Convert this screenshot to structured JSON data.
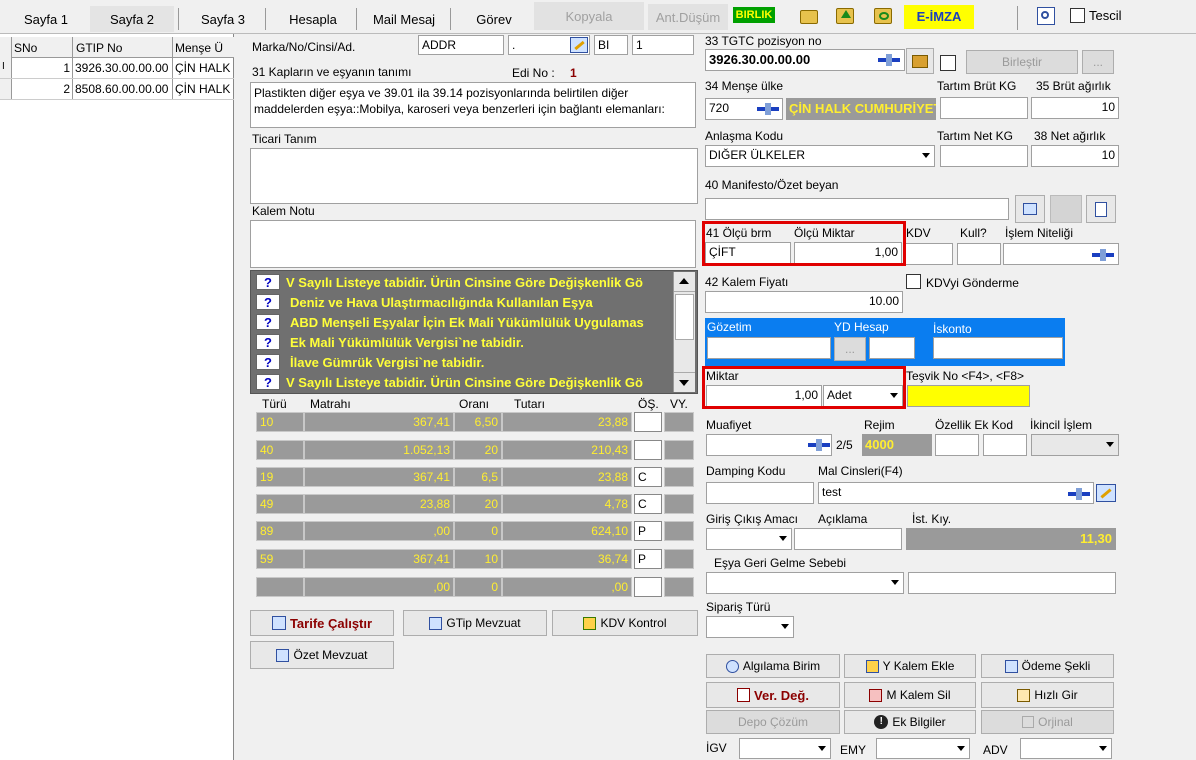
{
  "tabs": [
    {
      "label": "Sayfa 1"
    },
    {
      "label": "Sayfa 2"
    },
    {
      "label": "Sayfa 3"
    },
    {
      "label": "Hesapla"
    },
    {
      "label": "Mail Mesaj"
    },
    {
      "label": "Görev"
    },
    {
      "label": "Kopyala"
    },
    {
      "label": "Ant.Düşüm"
    }
  ],
  "toolbar": {
    "birlik": "BIRLIK",
    "eimza": "E-İMZA",
    "tescil": "Tescil"
  },
  "left_table": {
    "headers": [
      "SNo",
      "GTIP No",
      "Menşe Ü"
    ],
    "rows": [
      {
        "sno": "1",
        "gtip": "3926.30.00.00.00",
        "mense": "ÇİN HALK"
      },
      {
        "sno": "2",
        "gtip": "8508.60.00.00.00",
        "mense": "ÇİN HALK"
      }
    ]
  },
  "form": {
    "marka_label": "Marka/No/Cinsi/Ad.",
    "marka_val1": "ADDR",
    "marka_val2": ".",
    "marka_val3": "BI",
    "marka_val4": "1",
    "kaplar_label": "31 Kapların ve eşyanın tanımı",
    "edi_label": "Edi No :",
    "edi_val": "1",
    "esya_tanim": "Plastikten diğer eşya ve 39.01 ila 39.14 pozisyonlarında belirtilen diğer maddelerden eşya::Mobilya, karoseri veya benzerleri için bağlantı elemanları:",
    "ticari_label": "Ticari Tanım",
    "kalem_notu_label": "Kalem Notu",
    "warnings": [
      "V Sayılı Listeye tabidir. Ürün Cinsine Göre Değişkenlik Gö",
      "Deniz ve Hava Ulaştırmacılığında Kullanılan Eşya",
      "ABD Menşeli Eşyalar İçin Ek Mali Yükümlülük Uygulamas",
      "Ek Mali Yükümlülük Vergisi`ne tabidir.",
      "İlave Gümrük Vergisi`ne tabidir.",
      "V Sayılı Listeye tabidir. Ürün Cinsine Göre Değişkenlik Gö"
    ],
    "tax_headers": [
      "Türü",
      "Matrahı",
      "Oranı",
      "Tutarı",
      "ÖŞ.",
      "VY."
    ],
    "tax_rows": [
      {
        "tur": "10",
        "matrah": "367,41",
        "oran": "6,50",
        "tutar": "23,88",
        "os": ""
      },
      {
        "tur": "40",
        "matrah": "1.052,13",
        "oran": "20",
        "tutar": "210,43",
        "os": ""
      },
      {
        "tur": "19",
        "matrah": "367,41",
        "oran": "6,5",
        "tutar": "23,88",
        "os": "C"
      },
      {
        "tur": "49",
        "matrah": "23,88",
        "oran": "20",
        "tutar": "4,78",
        "os": "C"
      },
      {
        "tur": "89",
        "matrah": ",00",
        "oran": "0",
        "tutar": "624,10",
        "os": "P"
      },
      {
        "tur": "59",
        "matrah": "367,41",
        "oran": "10",
        "tutar": "36,74",
        "os": "P"
      },
      {
        "tur": "",
        "matrah": ",00",
        "oran": "0",
        "tutar": ",00",
        "os": ""
      }
    ],
    "btn_tarife": "Tarife Çalıştır",
    "btn_gtip": "GTip Mevzuat",
    "btn_kdv": "KDV Kontrol",
    "btn_ozet": "Özet Mevzuat"
  },
  "right": {
    "tgtc_label": "33 TGTC pozisyon no",
    "tgtc_val": "3926.30.00.00.00",
    "birlestir": "Birleştir",
    "mense_label": "34 Menşe ülke",
    "mense_code": "720",
    "mense_name": "ÇİN HALK CUMHURİYETİ",
    "tartim_brut_label": "Tartım Brüt KG",
    "brut_label": "35 Brüt ağırlık",
    "brut_val": "10",
    "anlasma_label": "Anlaşma Kodu",
    "anlasma_val": "DIĞER ÜLKELER",
    "tartim_net_label": "Tartım Net KG",
    "net_label": "38 Net ağırlık",
    "net_val": "10",
    "manifesto_label": "40 Manifesto/Özet beyan",
    "olcu_brm_label": "41 Ölçü brm",
    "olcu_miktar_label": "Ölçü Miktar",
    "kdv_label": "KDV",
    "kull_label": "Kull?",
    "islem_label": "İşlem Niteliği",
    "olcu_brm_val": "ÇİFT",
    "olcu_miktar_val": "1,00",
    "kalem_fiyat_label": "42 Kalem Fiyatı",
    "kdvyi_label": "KDVyi Gönderme",
    "kalem_fiyat_val": "10.00",
    "gozetim_label": "Gözetim",
    "yd_label": "YD Hesap",
    "iskonto_label": "İskonto",
    "miktar_label": "Miktar",
    "tesvik_label": "Teşvik No <F4>, <F8>",
    "miktar_val": "1,00",
    "miktar_unit": "Adet",
    "muafiyet_label": "Muafiyet",
    "rejim_label": "Rejim",
    "ozellik_label": "Özellik Ek Kod",
    "ikincil_label": "İkincil İşlem",
    "rejim_frac": "2/5",
    "rejim_val": "4000",
    "damping_label": "Damping Kodu",
    "mal_cins_label": "Mal Cinsleri(F4)",
    "mal_cins_val": "test",
    "giris_label": "Giriş Çıkış Amacı",
    "aciklama_label": "Açıklama",
    "ist_label": "İst. Kıy.",
    "ist_val": "11,30",
    "esya_geri_label": "Eşya Geri Gelme Sebebi",
    "siparis_label": "Sipariş Türü",
    "btn_algilama": "Algılama Birim",
    "btn_ykalem": "Y Kalem Ekle",
    "btn_odeme": "Ödeme Şekli",
    "btn_verdeg": "Ver. Değ.",
    "btn_mkalem": "M Kalem Sil",
    "btn_hizli": "Hızlı Gir",
    "btn_depo": "Depo Çözüm",
    "btn_ek": "Ek Bilgiler",
    "btn_orjinal": "Orjinal",
    "igv_label": "İGV",
    "emy_label": "EMY",
    "adv_label": "ADV"
  },
  "colors": {
    "accent_blue": "#0a7df0",
    "yellow": "#ffff00",
    "grid_gray": "#9a9a9a",
    "highlight_red": "#e00000"
  }
}
